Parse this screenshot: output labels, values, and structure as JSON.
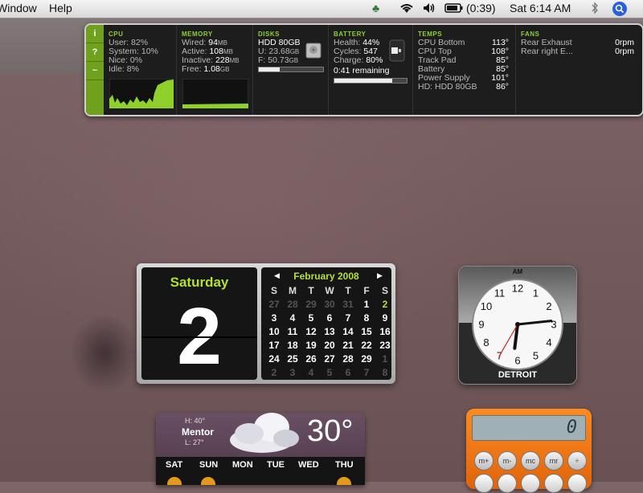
{
  "menubar": {
    "items": [
      "Window",
      "Help"
    ],
    "battery_time": "(0:39)",
    "clock": "Sat 6:14 AM"
  },
  "istat": {
    "tabs": [
      "i",
      "?",
      "~"
    ],
    "cpu": {
      "title": "CPU",
      "user_label": "User:",
      "user": "82%",
      "system_label": "System:",
      "system": "10%",
      "nice_label": "Nice:",
      "nice": "0%",
      "idle_label": "Idle:",
      "idle": "8%"
    },
    "memory": {
      "title": "MEMORY",
      "wired_label": "Wired:",
      "wired": "94",
      "wired_unit": "MB",
      "active_label": "Active:",
      "active": "108",
      "active_unit": "MB",
      "inactive_label": "Inactive:",
      "inactive": "228",
      "inactive_unit": "MB",
      "free_label": "Free:",
      "free": "1.08",
      "free_unit": "GB"
    },
    "disks": {
      "title": "DISKS",
      "name": "HDD 80GB",
      "used_label": "U:",
      "used": "23.68",
      "used_unit": "GB",
      "free_label": "F:",
      "free": "50.73",
      "free_unit": "GB",
      "used_fraction": 0.32
    },
    "battery": {
      "title": "BATTERY",
      "health_label": "Health:",
      "health": "44%",
      "cycles_label": "Cycles:",
      "cycles": "547",
      "charge_label": "Charge:",
      "charge": "80%",
      "remaining": "0:41 remaining",
      "charge_fraction": 0.8
    },
    "temps": {
      "title": "TEMPS",
      "rows": [
        {
          "label": "CPU Bottom",
          "value": "113°"
        },
        {
          "label": "CPU Top",
          "value": "108°"
        },
        {
          "label": "Track Pad",
          "value": "85°"
        },
        {
          "label": "Battery",
          "value": "85°"
        },
        {
          "label": "Power Supply",
          "value": "101°"
        },
        {
          "label": "HD: HDD 80GB",
          "value": "86°"
        }
      ]
    },
    "fans": {
      "title": "FANS",
      "rows": [
        {
          "label": "Rear Exhaust",
          "value": "0rpm"
        },
        {
          "label": "Rear right E...",
          "value": "0rpm"
        }
      ]
    }
  },
  "calendar": {
    "dayname": "Saturday",
    "daynum": "2",
    "month": "February 2008",
    "weekdays": [
      "S",
      "M",
      "T",
      "W",
      "T",
      "F",
      "S"
    ],
    "weeks": [
      [
        "27",
        "28",
        "29",
        "30",
        "31",
        "1",
        "2"
      ],
      [
        "3",
        "4",
        "5",
        "6",
        "7",
        "8",
        "9"
      ],
      [
        "10",
        "11",
        "12",
        "13",
        "14",
        "15",
        "16"
      ],
      [
        "17",
        "18",
        "19",
        "20",
        "21",
        "22",
        "23"
      ],
      [
        "24",
        "25",
        "26",
        "27",
        "28",
        "29",
        "1"
      ],
      [
        "2",
        "3",
        "4",
        "5",
        "6",
        "7",
        "8"
      ]
    ]
  },
  "clock": {
    "ampm": "AM",
    "city": "DETROIT",
    "numbers": [
      "12",
      "1",
      "2",
      "3",
      "4",
      "5",
      "6",
      "7",
      "8",
      "9",
      "10",
      "11"
    ],
    "hour": 6,
    "minute": 14,
    "second": 35
  },
  "weather": {
    "hi": "H: 40°",
    "city": "Mentor",
    "lo": "L: 27°",
    "temp": "30°",
    "days": [
      "SAT",
      "SUN",
      "MON",
      "TUE",
      "WED",
      "THU"
    ]
  },
  "calculator": {
    "display": "0",
    "keys": [
      "m+",
      "m-",
      "mc",
      "mr",
      "÷"
    ]
  },
  "colors": {
    "accent_green": "#8fd12a",
    "calendar_green": "#b7e12a",
    "calculator_orange": "#ff8a1e"
  }
}
